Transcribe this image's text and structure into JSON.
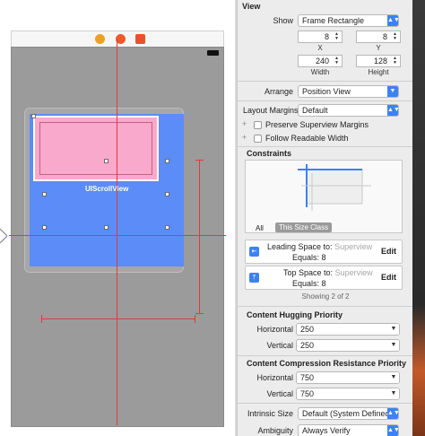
{
  "canvas": {
    "scroll_view_label": "UIScrollView"
  },
  "inspector": {
    "view_section": "View",
    "show_label": "Show",
    "show_value": "Frame Rectangle",
    "x_value": "8",
    "y_value": "8",
    "x_label": "X",
    "y_label": "Y",
    "width_value": "240",
    "height_value": "128",
    "width_label": "Width",
    "height_label": "Height",
    "arrange_label": "Arrange",
    "arrange_value": "Position View",
    "layout_margins_label": "Layout Margins",
    "layout_margins_value": "Default",
    "preserve_label": "Preserve Superview Margins",
    "follow_label": "Follow Readable Width",
    "constraints_title": "Constraints",
    "tab_all": "All",
    "tab_size_class": "This Size Class",
    "constraints": [
      {
        "name": "Leading Space to:",
        "placeholder": "Superview",
        "equals": "Equals:",
        "value": "8",
        "edit": "Edit"
      },
      {
        "name": "Top Space to:",
        "placeholder": "Superview",
        "equals": "Equals:",
        "value": "8",
        "edit": "Edit"
      }
    ],
    "showing": "Showing 2 of 2",
    "hugging_title": "Content Hugging Priority",
    "hugging_h_label": "Horizontal",
    "hugging_h_value": "250",
    "hugging_v_label": "Vertical",
    "hugging_v_value": "250",
    "compression_title": "Content Compression Resistance Priority",
    "compression_h_label": "Horizontal",
    "compression_h_value": "750",
    "compression_v_label": "Vertical",
    "compression_v_value": "750",
    "intrinsic_label": "Intrinsic Size",
    "intrinsic_value": "Default (System Defined)",
    "ambiguity_label": "Ambiguity",
    "ambiguity_value": "Always Verify"
  },
  "colors": {
    "accent": "#3b82f6",
    "constraint_red": "#e13b3b",
    "scroll_view_blue": "#5b8cf8",
    "content_pink": "#f8a9cc"
  }
}
